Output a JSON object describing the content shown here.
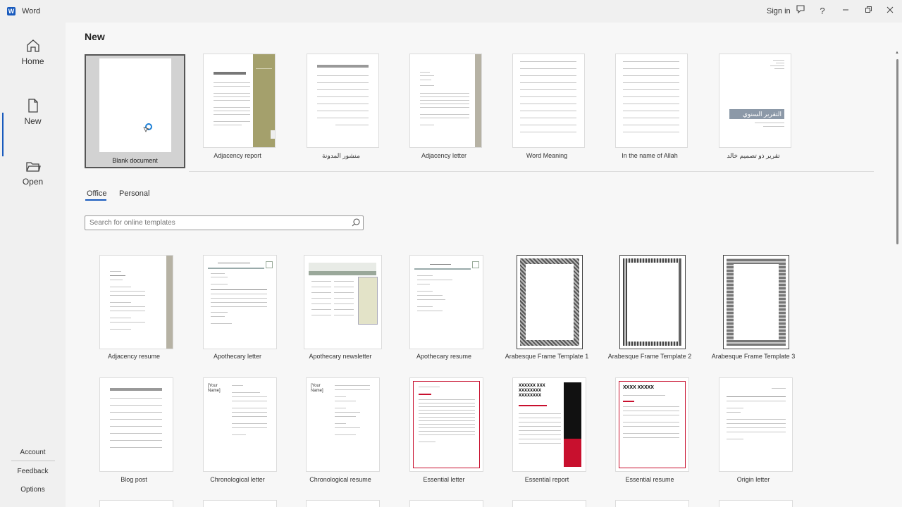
{
  "titlebar": {
    "app_name": "Word",
    "sign_in": "Sign in",
    "icons": [
      "word-logo-icon",
      "feedback-icon",
      "help-icon",
      "minimize-icon",
      "restore-icon",
      "close-icon"
    ],
    "help_glyph": "?"
  },
  "sidebar": {
    "items": [
      {
        "label": "Home",
        "icon": "home-icon",
        "active": false
      },
      {
        "label": "New",
        "icon": "new-document-icon",
        "active": true
      },
      {
        "label": "Open",
        "icon": "folder-icon",
        "active": false
      }
    ],
    "footer": [
      "Account",
      "Feedback",
      "Options"
    ]
  },
  "main": {
    "title": "New",
    "featured": [
      {
        "label": "Blank document",
        "selected": true
      },
      {
        "label": "Adjacency report"
      },
      {
        "label": "منشور المدونة"
      },
      {
        "label": "Adjacency letter"
      },
      {
        "label": "Word Meaning"
      },
      {
        "label": "In the name of Allah"
      },
      {
        "label": "تقرير ذو تصميم خالد",
        "thumb_title": "التقرير السنوي"
      }
    ],
    "tabs": [
      {
        "label": "Office",
        "active": true
      },
      {
        "label": "Personal",
        "active": false
      }
    ],
    "search": {
      "placeholder": "Search for online templates",
      "value": ""
    },
    "templates_row1": [
      {
        "label": "Adjacency resume"
      },
      {
        "label": "Apothecary letter"
      },
      {
        "label": "Apothecary newsletter"
      },
      {
        "label": "Apothecary resume"
      },
      {
        "label": "Arabesque Frame Template 1"
      },
      {
        "label": "Arabesque Frame Template 2"
      },
      {
        "label": "Arabesque Frame Template 3"
      }
    ],
    "templates_row2": [
      {
        "label": "Blog post"
      },
      {
        "label": "Chronological letter",
        "thumb_text": "[Your Name]"
      },
      {
        "label": "Chronological resume",
        "thumb_text": "[Your Name]"
      },
      {
        "label": "Essential letter"
      },
      {
        "label": "Essential report",
        "thumb_text": "XXXXXX XXX XXXXXXXX XXXXXXXX"
      },
      {
        "label": "Essential resume",
        "thumb_text": "XXXX XXXXX"
      },
      {
        "label": "Origin letter"
      }
    ]
  },
  "colors": {
    "accent": "#185abd",
    "essential_red": "#c8102e",
    "adjacency_olive": "#a4a06c"
  }
}
